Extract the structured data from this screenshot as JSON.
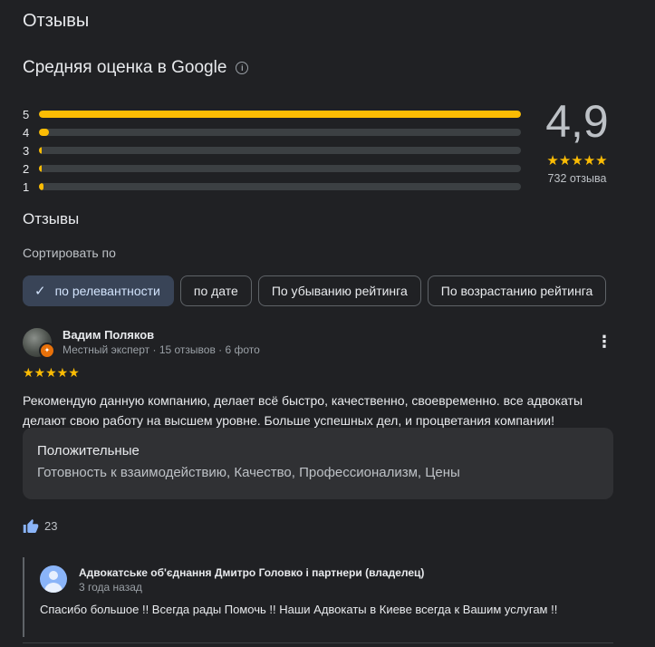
{
  "page_title": "Отзывы",
  "rating_summary": {
    "title": "Средняя оценка в Google",
    "score": "4,9",
    "stars": "★★★★★",
    "count_label": "732 отзыва",
    "distribution": [
      {
        "label": "5",
        "fraction": 1.0
      },
      {
        "label": "4",
        "fraction": 0.02
      },
      {
        "label": "3",
        "fraction": 0.004
      },
      {
        "label": "2",
        "fraction": 0.003
      },
      {
        "label": "1",
        "fraction": 0.009
      }
    ]
  },
  "reviews_section": {
    "heading": "Отзывы",
    "sort_label": "Сортировать по",
    "sort_options": [
      {
        "label": "по релевантности",
        "selected": true
      },
      {
        "label": "по дате",
        "selected": false
      },
      {
        "label": "По убыванию рейтинга",
        "selected": false
      },
      {
        "label": "По возрастанию рейтинга",
        "selected": false
      }
    ]
  },
  "review": {
    "author": "Вадим Поляков",
    "meta": "Местный эксперт · 15 отзывов · 6 фото",
    "rating": 5,
    "stars": "★★★★★",
    "text": "Рекомендую данную компанию, делает всё быстро, качественно, своевременно. все адвокаты делают свою работу на высшем уровне. Больше успешных дел, и процветания компании!",
    "tags_title": "Положительные",
    "tags": "Готовность к взаимодействию, Качество, Профессионализм, Цены",
    "likes": "23"
  },
  "owner_reply": {
    "author": "Адвокатське об'єднання Дмитро Головко і партнери (владелец)",
    "time": "3 года назад",
    "text": "Спасибо большое !! Всегда рады Помочь !! Наши Адвокаты в Киеве всегда к Вашим услугам !!"
  },
  "colors": {
    "background": "#202124",
    "star": "#fbbc04",
    "bar_track": "#3c4043",
    "chip_selected": "#394457",
    "accent_blue": "#8ab4f8"
  }
}
